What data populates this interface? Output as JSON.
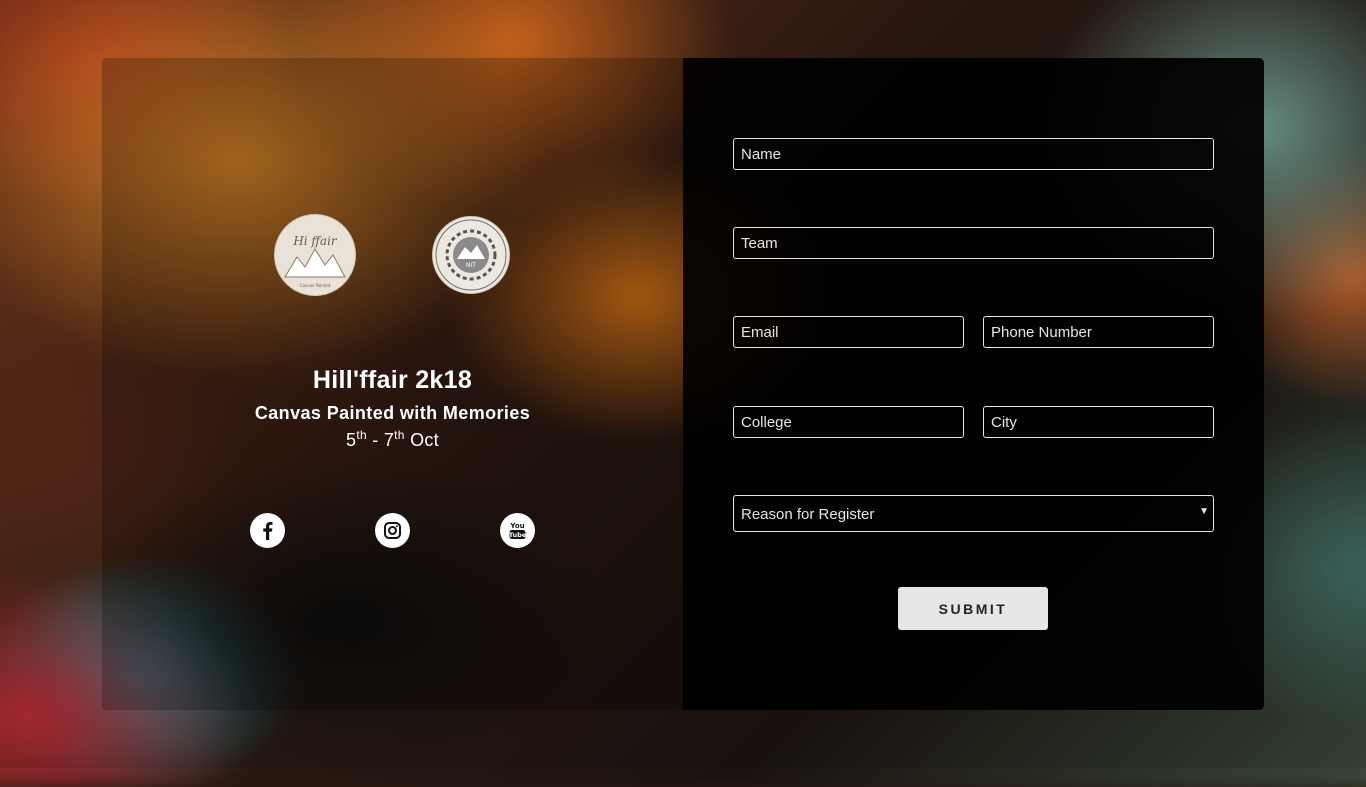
{
  "event": {
    "title": "Hill'ffair 2k18",
    "tagline": "Canvas Painted with Memories",
    "dates": {
      "start_day": "5",
      "start_suffix": "th",
      "separator": " - ",
      "end_day": "7",
      "end_suffix": "th",
      "month": " Oct"
    }
  },
  "logos": {
    "hillffair_text": "Hi ffair",
    "hillffair_sub": "Canvas Painted",
    "nit_text": "NIT"
  },
  "social": {
    "facebook_icon": "facebook-icon",
    "instagram_icon": "instagram-icon",
    "youtube_icon": "youtube-icon",
    "youtube_text_top": "You",
    "youtube_text_bottom": "Tube"
  },
  "form": {
    "name_placeholder": "Name",
    "team_placeholder": "Team",
    "email_placeholder": "Email",
    "phone_placeholder": "Phone Number",
    "college_placeholder": "College",
    "city_placeholder": "City",
    "reason_label": "Reason for Register",
    "reason_arrow": "▼",
    "submit_label": "SUBMIT"
  },
  "colors": {
    "form_background": "#000000",
    "field_border": "#e6e6e6",
    "button_background": "#e6e6e6",
    "text_light": "#ffffff"
  }
}
